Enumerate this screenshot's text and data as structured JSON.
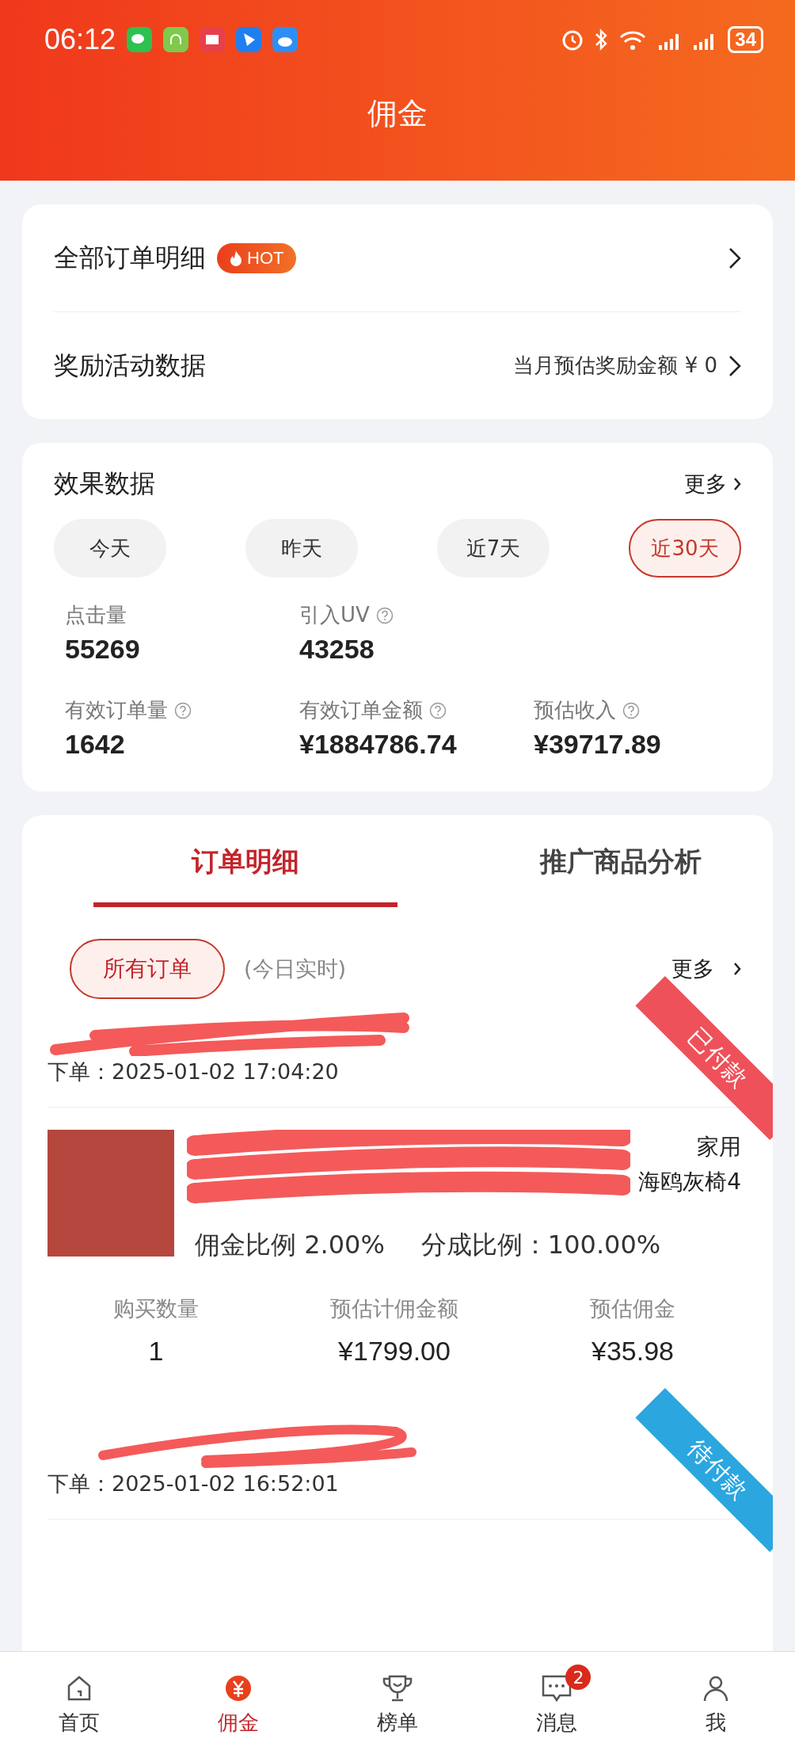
{
  "status_bar": {
    "time": "06:12",
    "battery": "34"
  },
  "header": {
    "title": "佣金"
  },
  "links": [
    {
      "label": "全部订单明细",
      "badge": "HOT"
    },
    {
      "label": "奖励活动数据",
      "value": "当月预估奖励金额 ¥ 0"
    }
  ],
  "performance": {
    "title": "效果数据",
    "more": "更多",
    "periods": [
      {
        "label": "今天",
        "selected": false
      },
      {
        "label": "昨天",
        "selected": false
      },
      {
        "label": "近7天",
        "selected": false
      },
      {
        "label": "近30天",
        "selected": true
      }
    ],
    "stats": [
      {
        "label": "点击量",
        "value": "55269",
        "help": false
      },
      {
        "label": "引入UV",
        "value": "43258",
        "help": true
      },
      {
        "label": "有效订单量",
        "value": "1642",
        "help": true
      },
      {
        "label": "有效订单金额",
        "value": "¥1884786.74",
        "help": true
      },
      {
        "label": "预估收入",
        "value": "¥39717.89",
        "help": true
      }
    ]
  },
  "orders": {
    "tabs": [
      {
        "label": "订单明细",
        "selected": true
      },
      {
        "label": "推广商品分析",
        "selected": false
      }
    ],
    "filter": {
      "label": "所有订单",
      "selected": true
    },
    "note": "(今日实时)",
    "more": "更多",
    "items": [
      {
        "status": "已付款",
        "color": "#ee5159",
        "order_time": "下单：2025-01-02 17:04:20",
        "title_lines": [
          "家用",
          "海鸥灰椅4"
        ],
        "commission_rate": "佣金比例 2.00%",
        "share_rate": "分成比例：100.00%",
        "metrics": [
          {
            "label": "购买数量",
            "value": "1"
          },
          {
            "label": "预估计佣金额",
            "value": "¥1799.00"
          },
          {
            "label": "预估佣金",
            "value": "¥35.98"
          }
        ]
      },
      {
        "status": "待付款",
        "color": "#2ba6df",
        "order_time": "下单：2025-01-02 16:52:01"
      }
    ]
  },
  "tab_bar": [
    {
      "kind": "home",
      "label": "首页",
      "selected": false
    },
    {
      "kind": "yen",
      "label": "佣金",
      "selected": true
    },
    {
      "kind": "trophy",
      "label": "榜单",
      "selected": false
    },
    {
      "kind": "message",
      "label": "消息",
      "selected": false,
      "badge": "2"
    },
    {
      "kind": "person",
      "label": "我",
      "selected": false
    }
  ]
}
